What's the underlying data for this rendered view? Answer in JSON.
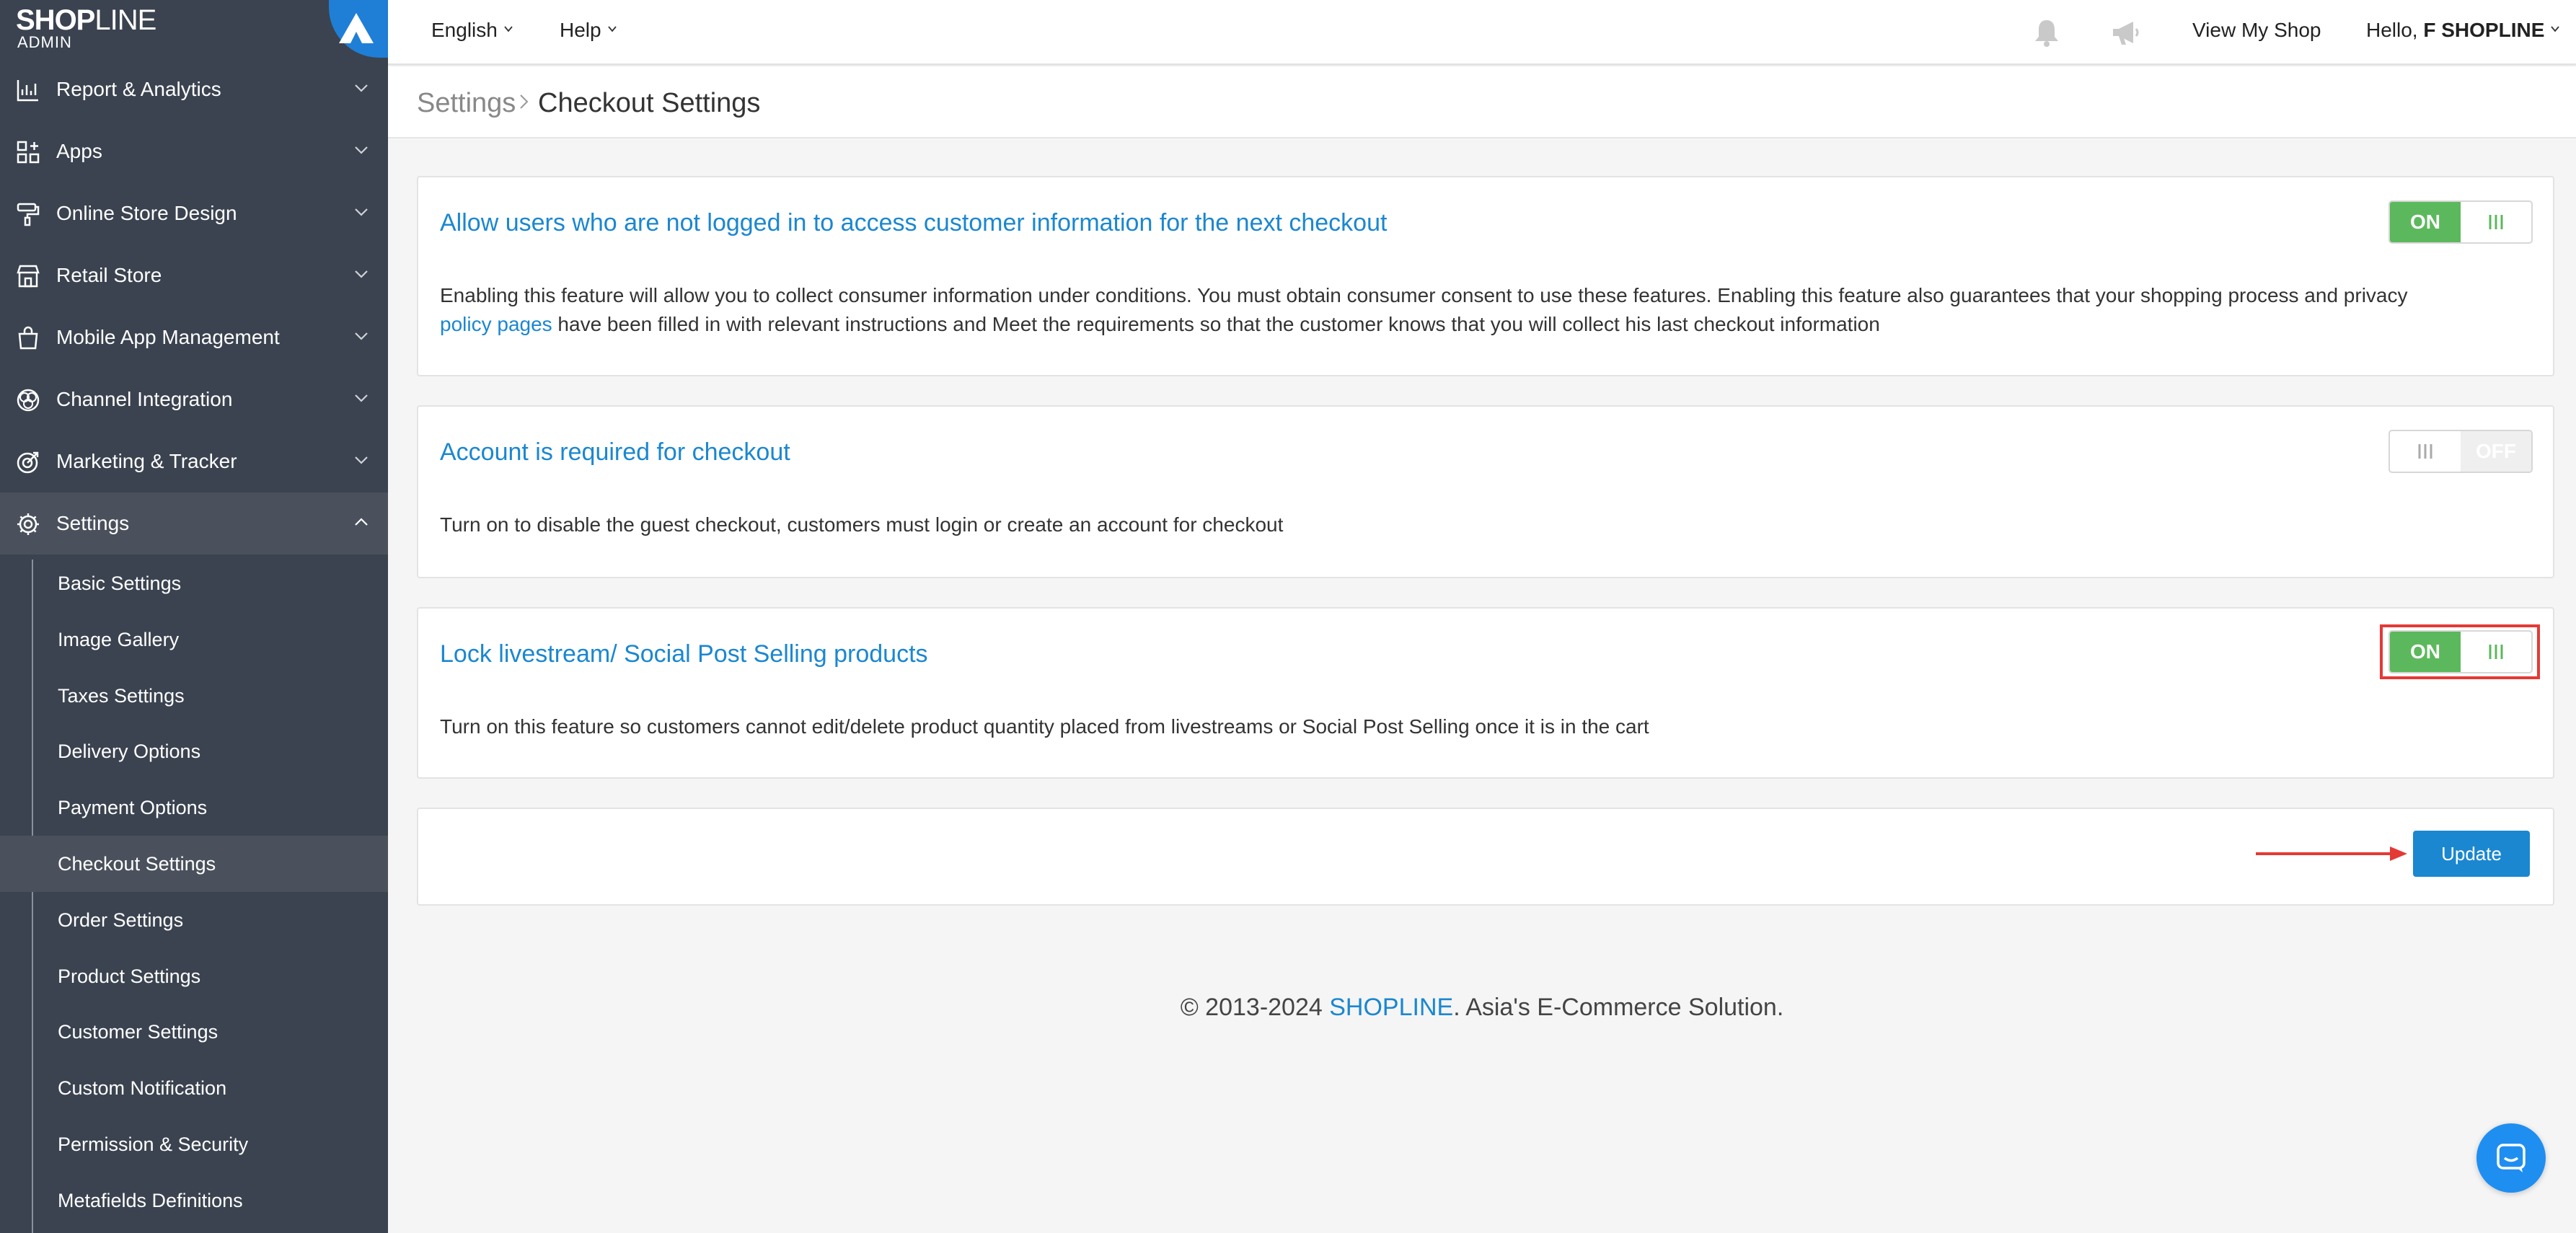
{
  "brand": {
    "logo_bold": "SHOP",
    "logo_thin": "LINE",
    "logo_sub": "ADMIN"
  },
  "sidebar": {
    "items": [
      {
        "label": "Report & Analytics",
        "icon": "chart-icon"
      },
      {
        "label": "Apps",
        "icon": "apps-icon"
      },
      {
        "label": "Online Store Design",
        "icon": "paint-roller-icon"
      },
      {
        "label": "Retail Store",
        "icon": "store-icon"
      },
      {
        "label": "Mobile App Management",
        "icon": "bag-icon"
      },
      {
        "label": "Channel Integration",
        "icon": "channels-icon"
      },
      {
        "label": "Marketing & Tracker",
        "icon": "target-icon"
      },
      {
        "label": "Settings",
        "icon": "gear-icon"
      }
    ],
    "sub_items": [
      "Basic Settings",
      "Image Gallery",
      "Taxes Settings",
      "Delivery Options",
      "Payment Options",
      "Checkout Settings",
      "Order Settings",
      "Product Settings",
      "Customer Settings",
      "Custom Notification",
      "Permission & Security",
      "Metafields Definitions"
    ]
  },
  "topbar": {
    "language": "English",
    "help": "Help",
    "view_shop": "View My Shop",
    "greeting": "Hello,",
    "user": "F SHOPLINE"
  },
  "breadcrumb": {
    "root": "Settings",
    "current": "Checkout Settings"
  },
  "cards": [
    {
      "title": "Allow users who are not logged in to access customer information for the next checkout",
      "desc_1": "Enabling this feature will allow you to collect consumer information under conditions. You must obtain consumer consent to use these features. Enabling this feature also guarantees that your shopping process and privacy",
      "desc_link": "policy pages",
      "desc_2": " have been filled in with relevant instructions and Meet the requirements so that the customer knows that you will collect his last checkout information",
      "toggle": "ON"
    },
    {
      "title": "Account is required for checkout",
      "desc": "Turn on to disable the guest checkout, customers must login or create an account for checkout",
      "toggle": "OFF"
    },
    {
      "title": "Lock livestream/ Social Post Selling products",
      "desc": "Turn on this feature so customers cannot edit/delete product quantity placed from livestreams or Social Post Selling once it is in the cart",
      "toggle": "ON"
    }
  ],
  "update_label": "Update",
  "footer": {
    "prefix": "© 2013-2024 ",
    "brand": "SHOPLINE",
    "suffix": ". Asia's E-Commerce Solution."
  },
  "colors": {
    "sidebar_bg": "#3b4350",
    "accent": "#1a87d0",
    "toggle_on": "#5cb85c",
    "highlight": "#e53935"
  }
}
